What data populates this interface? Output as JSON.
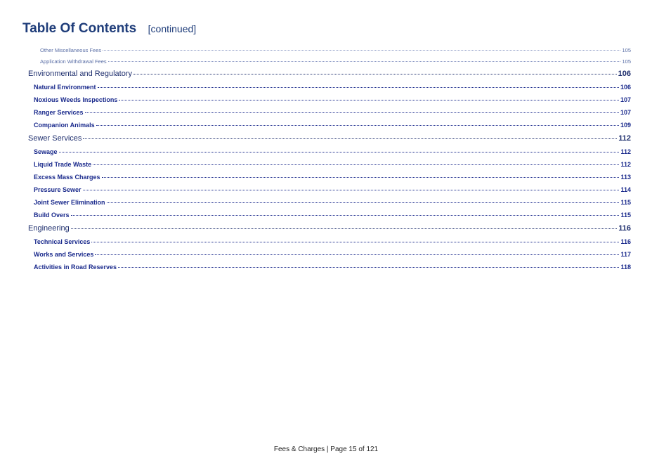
{
  "heading": {
    "title": "Table Of Contents",
    "subtitle": "[continued]"
  },
  "toc": [
    {
      "level": 3,
      "title": "Other Miscellaneous Fees",
      "page": "105"
    },
    {
      "level": 3,
      "title": "Application Withdrawal Fees",
      "page": "105"
    },
    {
      "level": 1,
      "title": "Environmental and Regulatory",
      "page": "106"
    },
    {
      "level": 2,
      "title": "Natural Environment",
      "page": "106"
    },
    {
      "level": 2,
      "title": "Noxious Weeds Inspections",
      "page": "107"
    },
    {
      "level": 2,
      "title": "Ranger Services",
      "page": "107"
    },
    {
      "level": 2,
      "title": "Companion Animals",
      "page": "109"
    },
    {
      "level": 1,
      "title": "Sewer Services",
      "page": "112"
    },
    {
      "level": 2,
      "title": "Sewage",
      "page": "112"
    },
    {
      "level": 2,
      "title": "Liquid Trade Waste",
      "page": "112"
    },
    {
      "level": 2,
      "title": "Excess Mass Charges",
      "page": "113"
    },
    {
      "level": 2,
      "title": "Pressure Sewer",
      "page": "114"
    },
    {
      "level": 2,
      "title": "Joint Sewer Elimination",
      "page": "115"
    },
    {
      "level": 2,
      "title": "Build Overs",
      "page": "115"
    },
    {
      "level": 1,
      "title": "Engineering",
      "page": "116"
    },
    {
      "level": 2,
      "title": "Technical Services",
      "page": "116"
    },
    {
      "level": 2,
      "title": "Works and Services",
      "page": "117"
    },
    {
      "level": 2,
      "title": "Activities in Road Reserves",
      "page": "118"
    }
  ],
  "footer": {
    "text": "Fees & Charges | Page 15 of 121"
  }
}
